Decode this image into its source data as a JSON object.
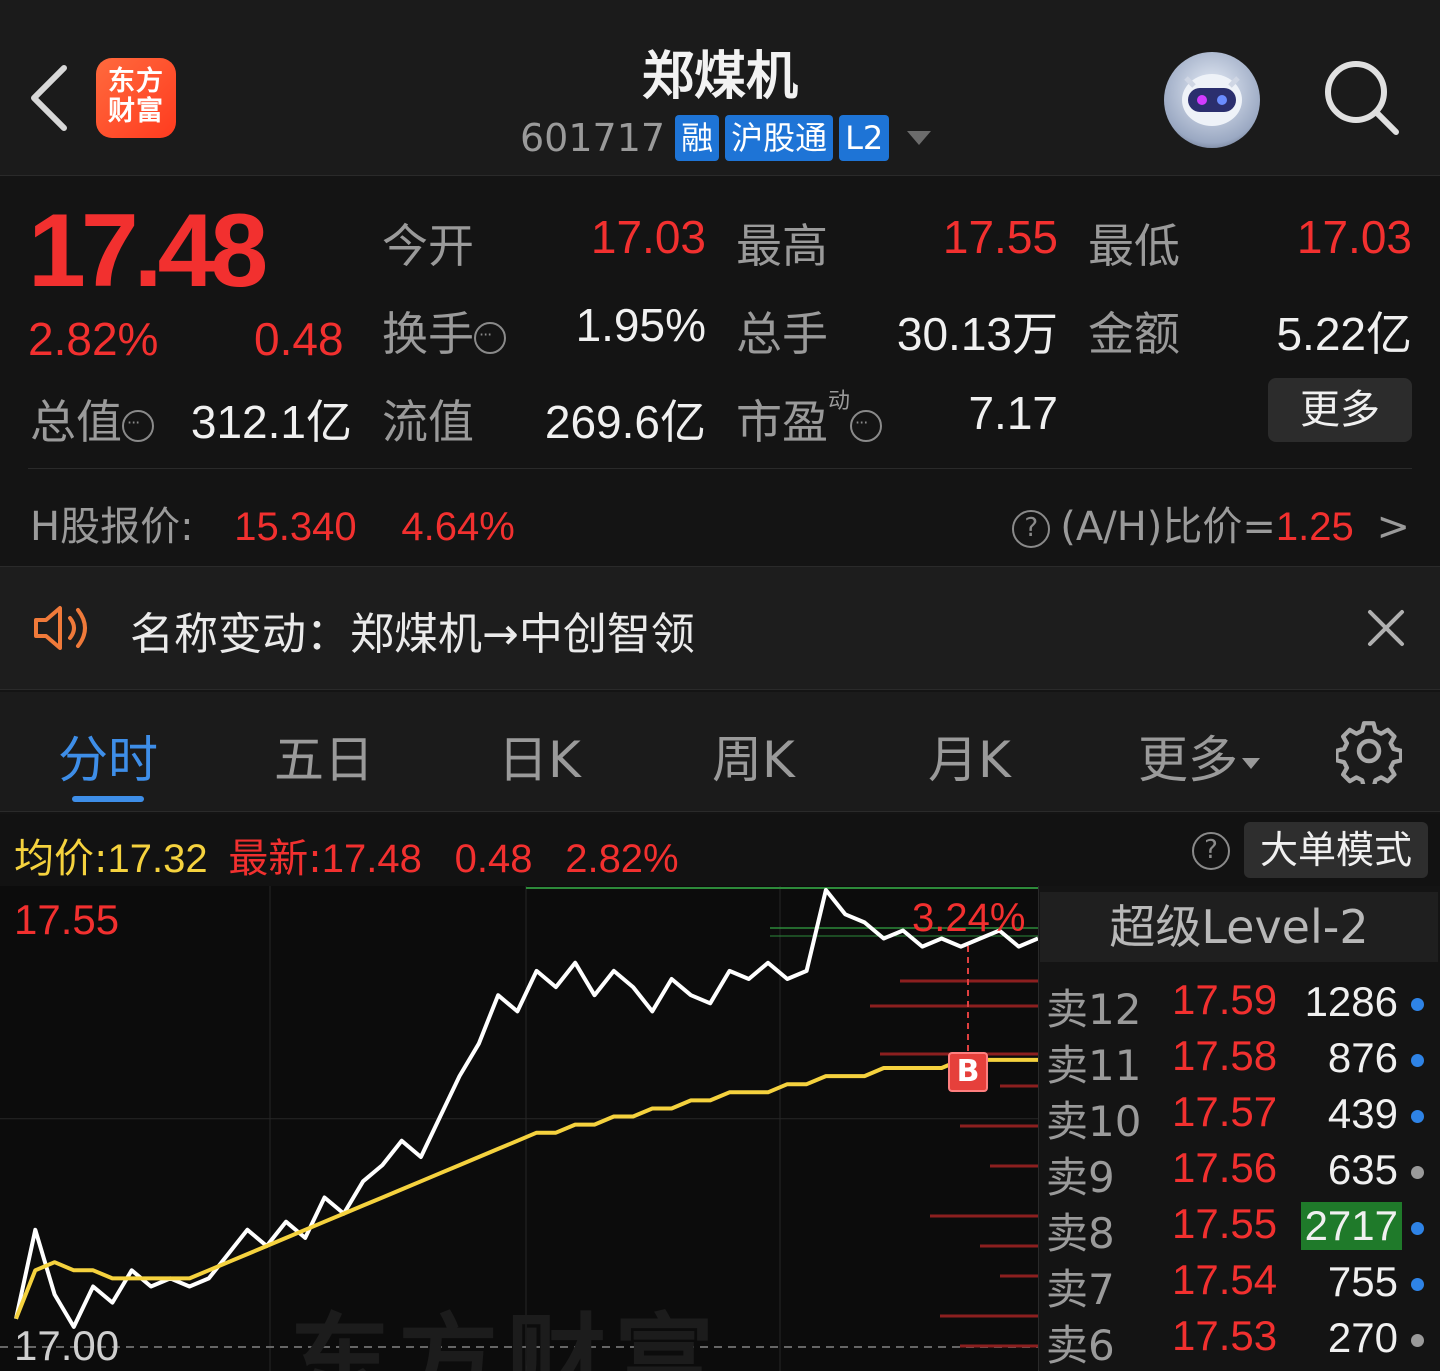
{
  "header": {
    "title": "郑煤机",
    "code": "601717",
    "tags": [
      "融",
      "沪股通",
      "L2"
    ],
    "logo_text": "东方财富"
  },
  "quote": {
    "price": "17.48",
    "change_pct": "2.82%",
    "change": "0.48",
    "stats": [
      {
        "label": "今开",
        "value": "17.03",
        "color": "red"
      },
      {
        "label": "最高",
        "value": "17.55",
        "color": "red"
      },
      {
        "label": "最低",
        "value": "17.03",
        "color": "red"
      },
      {
        "label": "换手",
        "value": "1.95%",
        "color": "white"
      },
      {
        "label": "总手",
        "value": "30.13万",
        "color": "white"
      },
      {
        "label": "金额",
        "value": "5.22亿",
        "color": "white"
      },
      {
        "label": "总值",
        "value": "312.1亿",
        "color": "white"
      },
      {
        "label": "流值",
        "value": "269.6亿",
        "color": "white"
      },
      {
        "label": "市盈",
        "superscript": "动",
        "value": "7.17",
        "color": "white"
      }
    ],
    "more_label": "更多"
  },
  "hshare": {
    "label": "H股报价:",
    "price": "15.340",
    "change_pct": "4.64%",
    "ah_label": "(A/H)比价=",
    "ah_value": "1.25",
    "arrow": ">"
  },
  "notice": {
    "text": "名称变动：郑煤机→中创智领"
  },
  "tabs": [
    {
      "label": "分时",
      "active": true
    },
    {
      "label": "五日"
    },
    {
      "label": "日K"
    },
    {
      "label": "周K"
    },
    {
      "label": "月K"
    },
    {
      "label": "更多"
    }
  ],
  "infobar": {
    "avg_label": "均价:",
    "avg_value": "17.32",
    "latest_label": "最新:",
    "latest_value": "17.48",
    "latest_change": "0.48",
    "latest_pct": "2.82%",
    "bigorder_label": "大单模式"
  },
  "chart_data": {
    "type": "line",
    "y_top_label": "17.55",
    "y_bottom_label": "17.00",
    "pct_label": "3.24%",
    "marker": "B",
    "watermark": "东方财富",
    "ylim": [
      17.0,
      17.55
    ],
    "series": [
      {
        "name": "最新",
        "color": "#ffffff",
        "values": [
          17.02,
          17.13,
          17.05,
          17.01,
          17.06,
          17.04,
          17.08,
          17.06,
          17.07,
          17.06,
          17.07,
          17.1,
          17.13,
          17.11,
          17.14,
          17.12,
          17.17,
          17.15,
          17.19,
          17.21,
          17.24,
          17.22,
          17.27,
          17.32,
          17.36,
          17.42,
          17.4,
          17.45,
          17.43,
          17.46,
          17.42,
          17.45,
          17.43,
          17.4,
          17.44,
          17.42,
          17.41,
          17.45,
          17.44,
          17.46,
          17.44,
          17.45,
          17.55,
          17.52,
          17.51,
          17.49,
          17.5,
          17.48,
          17.49,
          17.48,
          17.49,
          17.5,
          17.48,
          17.49
        ]
      },
      {
        "name": "均价",
        "color": "#f5d23e",
        "values": [
          17.02,
          17.08,
          17.09,
          17.08,
          17.08,
          17.07,
          17.07,
          17.07,
          17.07,
          17.07,
          17.08,
          17.09,
          17.1,
          17.11,
          17.12,
          17.13,
          17.14,
          17.15,
          17.16,
          17.17,
          17.18,
          17.19,
          17.2,
          17.21,
          17.22,
          17.23,
          17.24,
          17.25,
          17.25,
          17.26,
          17.26,
          17.27,
          17.27,
          17.28,
          17.28,
          17.29,
          17.29,
          17.3,
          17.3,
          17.3,
          17.31,
          17.31,
          17.32,
          17.32,
          17.32,
          17.33,
          17.33,
          17.33,
          17.33,
          17.34,
          17.34,
          17.34,
          17.34,
          17.34
        ]
      }
    ]
  },
  "orderbook": {
    "title": "超级Level-2",
    "rows": [
      {
        "label": "卖12",
        "price": "17.59",
        "volume": "1286",
        "dot": "blue"
      },
      {
        "label": "卖11",
        "price": "17.58",
        "volume": "876",
        "dot": "blue"
      },
      {
        "label": "卖10",
        "price": "17.57",
        "volume": "439",
        "dot": "blue"
      },
      {
        "label": "卖9",
        "price": "17.56",
        "volume": "635",
        "dot": "grey"
      },
      {
        "label": "卖8",
        "price": "17.55",
        "volume": "2717",
        "dot": "blue"
      },
      {
        "label": "卖7",
        "price": "17.54",
        "volume": "755",
        "dot": "blue"
      },
      {
        "label": "卖6",
        "price": "17.53",
        "volume": "270",
        "dot": "grey"
      }
    ]
  }
}
